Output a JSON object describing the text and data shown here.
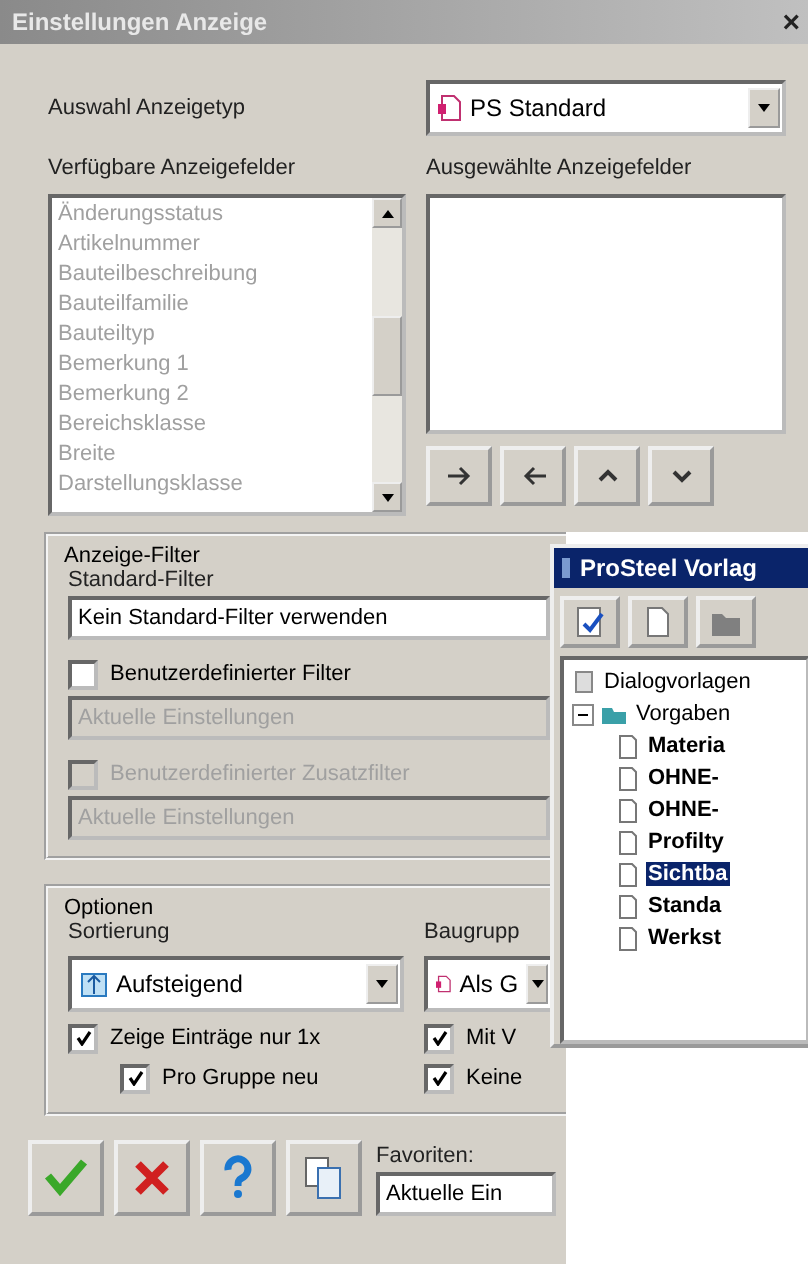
{
  "window": {
    "title": "Einstellungen Anzeige",
    "close": "×"
  },
  "display_type": {
    "label": "Auswahl Anzeigetyp",
    "value": "PS Standard"
  },
  "available_fields": {
    "label": "Verfügbare Anzeigefelder",
    "disabled": true,
    "items": [
      "Änderungsstatus",
      "Artikelnummer",
      "Bauteilbeschreibung",
      "Bauteilfamilie",
      "Bauteiltyp",
      "Bemerkung 1",
      "Bemerkung 2",
      "Bereichsklasse",
      "Breite",
      "Darstellungsklasse"
    ]
  },
  "selected_fields": {
    "label": "Ausgewählte Anzeigefelder"
  },
  "move_buttons": [
    {
      "kind": "right"
    },
    {
      "kind": "left"
    },
    {
      "kind": "up"
    },
    {
      "kind": "down"
    }
  ],
  "filter": {
    "title": "Anzeige-Filter",
    "standard_label": "Standard-Filter",
    "standard_value": "Kein Standard-Filter verwenden",
    "rows": [
      {
        "label": "Benutzerdefinierter Filter",
        "checked": false,
        "disabled": false,
        "value": "Aktuelle Einstellungen",
        "value_disabled": true
      },
      {
        "label": "Benutzerdefinierter Zusatzfilter",
        "checked": false,
        "disabled": true,
        "value": "Aktuelle Einstellungen",
        "value_disabled": true
      }
    ]
  },
  "options": {
    "title": "Optionen",
    "sort_label": "Sortierung",
    "sort_value": "Aufsteigend",
    "group_label": "Baugrupp",
    "group_value": "Als G",
    "left_checks": [
      {
        "label": "Zeige Einträge nur 1x",
        "checked": true,
        "indent": false
      },
      {
        "label": "Pro Gruppe neu",
        "checked": true,
        "indent": true
      }
    ],
    "right_checks": [
      {
        "label": "Mit V",
        "checked": true
      },
      {
        "label": "Keine",
        "checked": true
      }
    ]
  },
  "bottom_buttons": [
    {
      "kind": "ok"
    },
    {
      "kind": "cancel"
    },
    {
      "kind": "help"
    },
    {
      "kind": "copy"
    }
  ],
  "favorites": {
    "label": "Favoriten:",
    "value": "Aktuelle Ein"
  },
  "templates_window": {
    "title": "ProSteel Vorlag",
    "toolbar": [
      {
        "kind": "check"
      },
      {
        "kind": "new"
      },
      {
        "kind": "folder"
      }
    ],
    "tree": [
      {
        "label": "Dialogvorlagen",
        "kind": "root",
        "selected": false
      },
      {
        "label": "Vorgaben",
        "kind": "folder",
        "expanded": true,
        "selected": false,
        "children": [
          {
            "label": "Materia",
            "kind": "file",
            "selected": false
          },
          {
            "label": "OHNE-",
            "kind": "file",
            "selected": false
          },
          {
            "label": "OHNE-",
            "kind": "file",
            "selected": false
          },
          {
            "label": "Profilty",
            "kind": "file",
            "selected": false
          },
          {
            "label": "Sichtba",
            "kind": "file",
            "selected": true
          },
          {
            "label": "Standa",
            "kind": "file",
            "selected": false
          },
          {
            "label": "Werkst",
            "kind": "file",
            "selected": false
          }
        ]
      }
    ]
  }
}
